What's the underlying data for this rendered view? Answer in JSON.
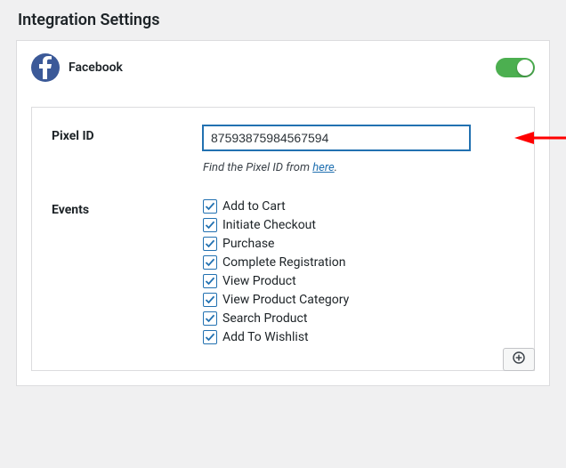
{
  "page": {
    "title": "Integration Settings"
  },
  "provider": {
    "name": "Facebook",
    "enabled": true
  },
  "pixel": {
    "label": "Pixel ID",
    "value": "87593875984567594",
    "hint_prefix": "Find the Pixel ID from ",
    "hint_link": "here",
    "hint_suffix": "."
  },
  "events": {
    "label": "Events",
    "items": [
      {
        "label": "Add to Cart",
        "checked": true
      },
      {
        "label": "Initiate Checkout",
        "checked": true
      },
      {
        "label": "Purchase",
        "checked": true
      },
      {
        "label": "Complete Registration",
        "checked": true
      },
      {
        "label": "View Product",
        "checked": true
      },
      {
        "label": "View Product Category",
        "checked": true
      },
      {
        "label": "Search Product",
        "checked": true
      },
      {
        "label": "Add To Wishlist",
        "checked": true
      }
    ]
  },
  "colors": {
    "accent": "#2271b1",
    "toggle_on": "#4caf50",
    "arrow": "#ff0000"
  }
}
